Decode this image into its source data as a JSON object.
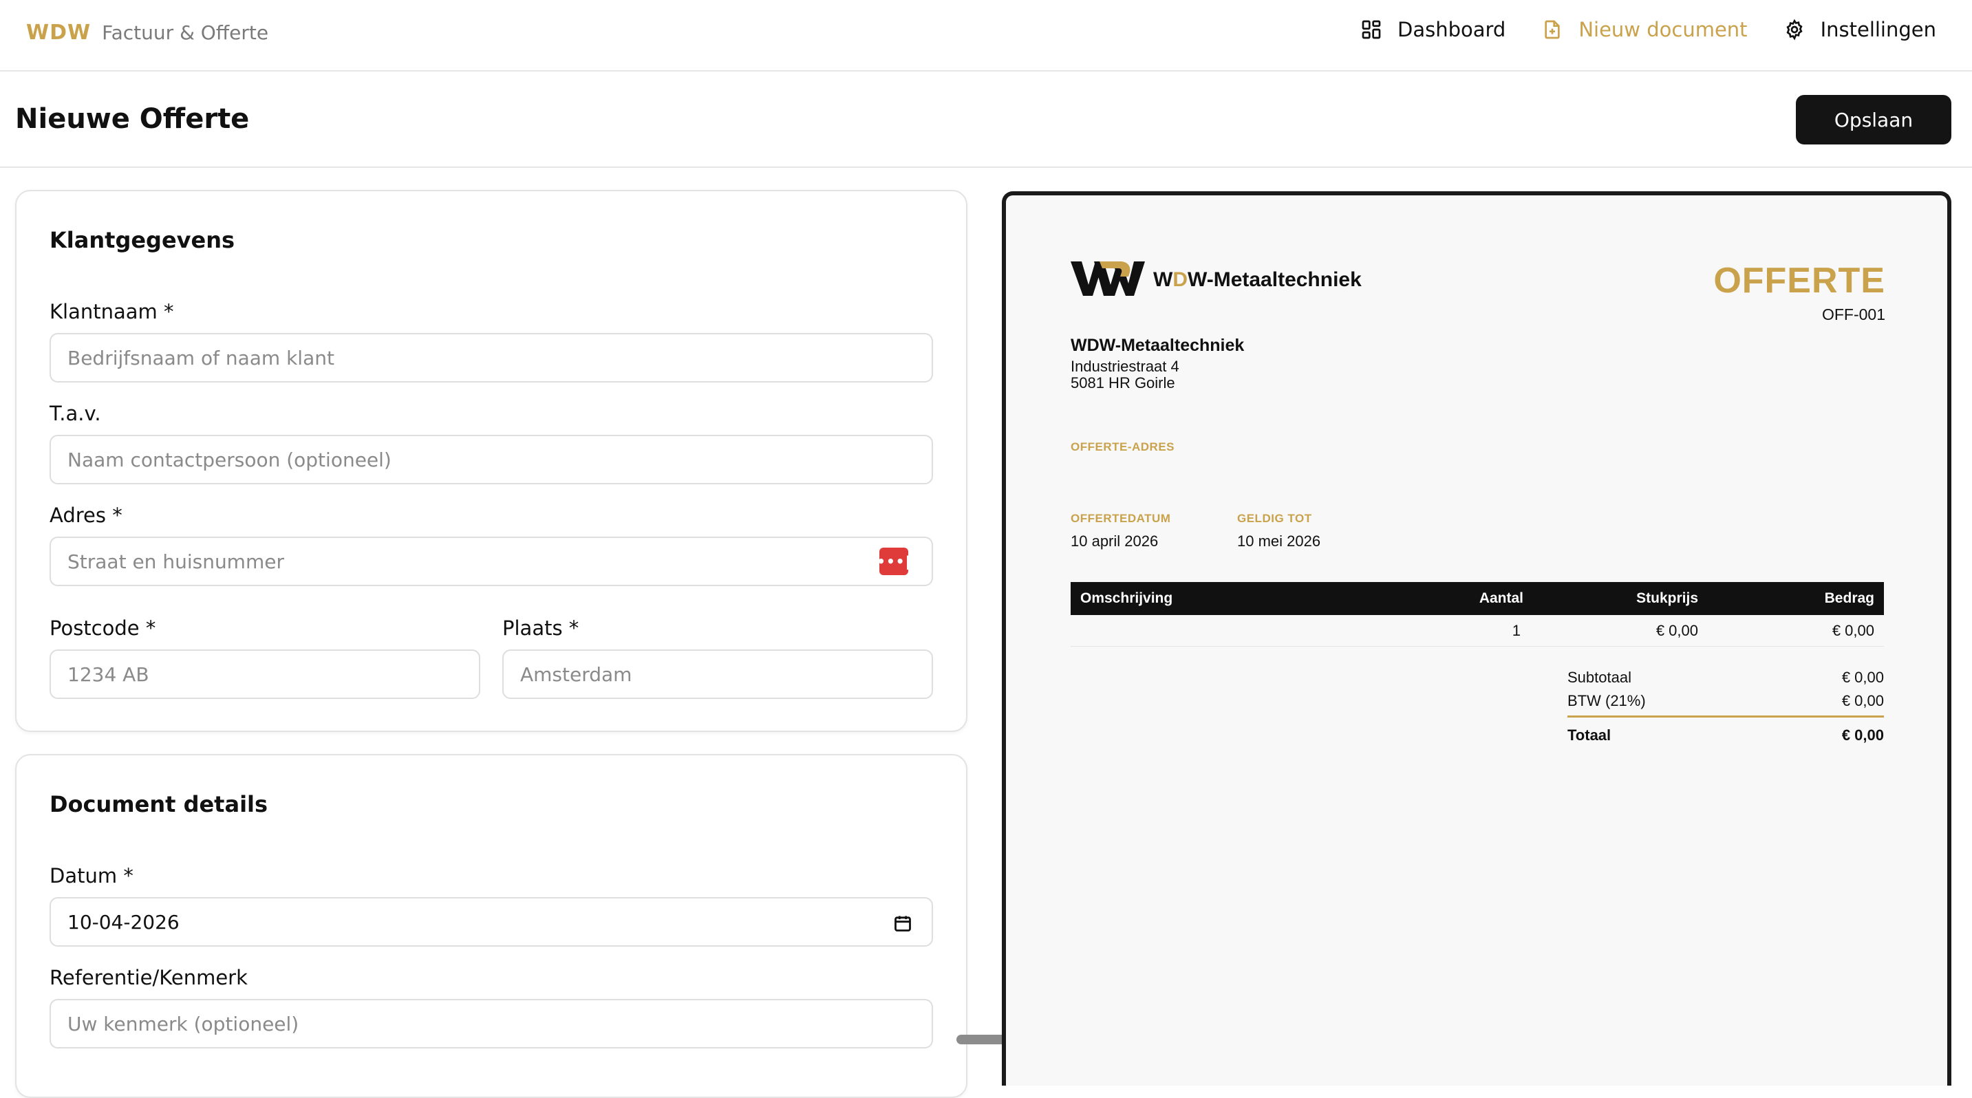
{
  "brand": {
    "mark": "WDW",
    "subtitle": "Factuur & Offerte"
  },
  "nav": [
    {
      "label": "Dashboard",
      "icon": "dashboard-icon"
    },
    {
      "label": "Nieuw document",
      "icon": "file-plus-icon",
      "active": true
    },
    {
      "label": "Instellingen",
      "icon": "gear-icon"
    }
  ],
  "page": {
    "title": "Nieuwe Offerte",
    "save_label": "Opslaan"
  },
  "client_card": {
    "title": "Klantgegevens",
    "name_label": "Klantnaam *",
    "name_placeholder": "Bedrijfsnaam of naam klant",
    "attn_label": "T.a.v.",
    "attn_placeholder": "Naam contactpersoon (optioneel)",
    "address_label": "Adres *",
    "address_placeholder": "Straat en huisnummer",
    "postcode_label": "Postcode *",
    "postcode_placeholder": "1234 AB",
    "city_label": "Plaats *",
    "city_placeholder": "Amsterdam"
  },
  "details_card": {
    "title": "Document details",
    "date_label": "Datum *",
    "date_value": "10-04-2026",
    "ref_label": "Referentie/Kenmerk",
    "ref_placeholder": "Uw kenmerk (optioneel)"
  },
  "preview": {
    "company_prefix": "W",
    "company_highlight": "D",
    "company_suffix": "W-Metaaltechniek",
    "doc_type": "OFFERTE",
    "doc_number": "OFF-001",
    "sender_name": "WDW-Metaaltechniek",
    "sender_street": "Industriestraat 4",
    "sender_city": "5081 HR Goirle",
    "address_label": "OFFERTE-ADRES",
    "date_label": "OFFERTEDATUM",
    "date_value": "10 april 2026",
    "valid_label": "GELDIG TOT",
    "valid_value": "10 mei 2026",
    "columns": [
      "Omschrijving",
      "Aantal",
      "Stukprijs",
      "Bedrag"
    ],
    "rows": [
      {
        "description": "",
        "qty": "1",
        "unit_price": "€ 0,00",
        "amount": "€ 0,00"
      }
    ],
    "subtotal_label": "Subtotaal",
    "subtotal_value": "€ 0,00",
    "vat_label": "BTW (21%)",
    "vat_value": "€ 0,00",
    "total_label": "Totaal",
    "total_value": "€ 0,00"
  },
  "colors": {
    "accent": "#c9a24b",
    "dark": "#141414",
    "danger": "#e03b3b"
  }
}
